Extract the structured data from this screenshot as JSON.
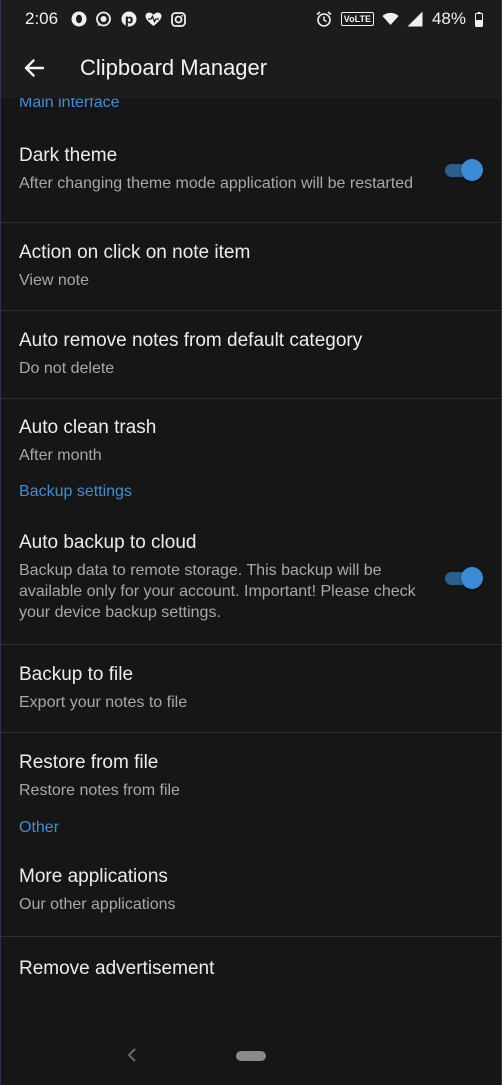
{
  "status_bar": {
    "time": "2:06",
    "volte": "VoLTE",
    "battery": "48%",
    "left_icons": [
      "opera-icon",
      "whatsapp-icon",
      "pinterest-icon",
      "heart-icon",
      "instagram-icon"
    ],
    "right_icons": [
      "alarm-icon",
      "volte-badge",
      "wifi-icon",
      "signal-icon",
      "battery-icon"
    ]
  },
  "toolbar": {
    "title": "Clipboard Manager",
    "back_icon": "arrow-back-icon"
  },
  "sections": {
    "main": {
      "header": "Main interface",
      "items": [
        {
          "title": "Dark theme",
          "subtitle": "After changing theme mode application will be restarted",
          "toggle": true
        },
        {
          "title": "Action on click on note item",
          "subtitle": "View note"
        },
        {
          "title": "Auto remove notes from default category",
          "subtitle": "Do not delete"
        },
        {
          "title": "Auto clean trash",
          "subtitle": "After month"
        }
      ]
    },
    "backup": {
      "header": "Backup settings",
      "items": [
        {
          "title": "Auto backup to cloud",
          "subtitle": "Backup data to remote storage. This backup will be available only for your account. Important! Please check your device backup settings.",
          "toggle": true
        },
        {
          "title": "Backup to file",
          "subtitle": "Export your notes to file"
        },
        {
          "title": "Restore from file",
          "subtitle": "Restore notes from file"
        }
      ]
    },
    "other": {
      "header": "Other",
      "items": [
        {
          "title": "More applications",
          "subtitle": "Our other applications"
        },
        {
          "title": "Remove advertisement"
        }
      ]
    }
  },
  "colors": {
    "background": "#161616",
    "accent": "#3f8fd8",
    "toggle_on": "#3a8ad6"
  }
}
